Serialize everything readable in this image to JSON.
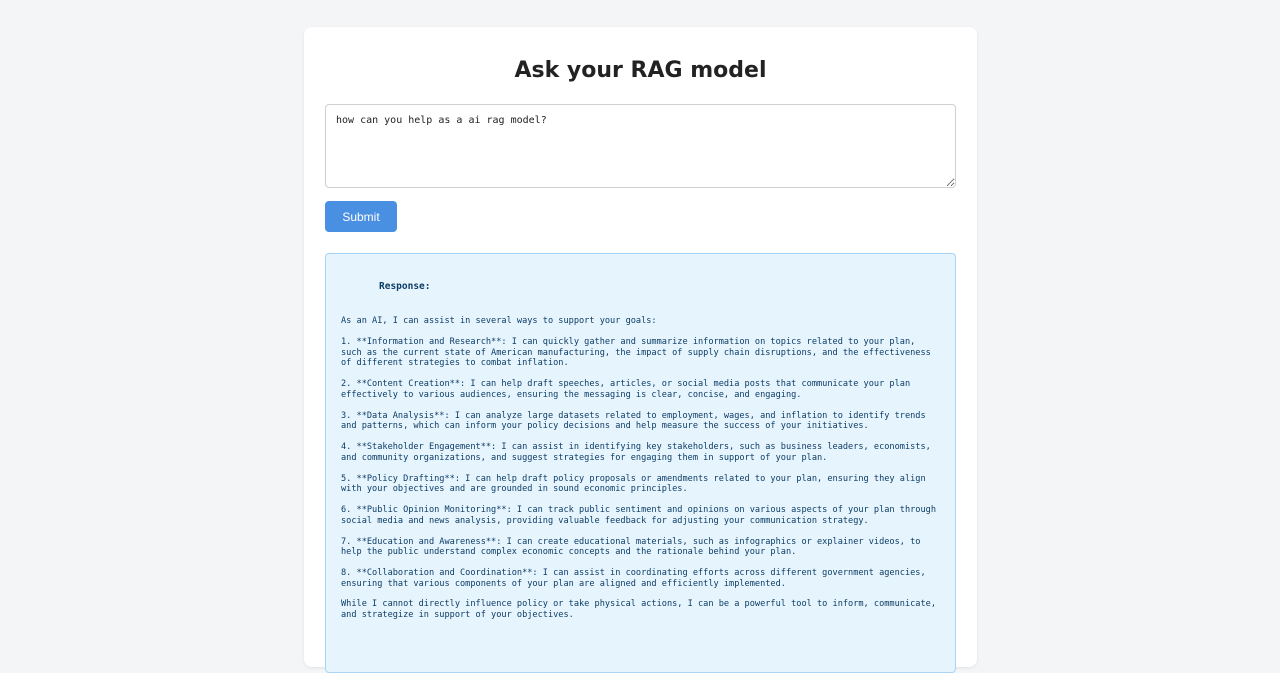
{
  "page": {
    "title": "Ask your RAG model"
  },
  "form": {
    "query_value": "how can you help as a ai rag model?",
    "submit_label": "Submit"
  },
  "response": {
    "label": "Response:",
    "intro": "As an AI, I can assist in several ways to support your goals:",
    "items": [
      "1. **Information and Research**: I can quickly gather and summarize information on topics related to your plan, such as the current state of American manufacturing, the impact of supply chain disruptions, and the effectiveness of different strategies to combat inflation.",
      "2. **Content Creation**: I can help draft speeches, articles, or social media posts that communicate your plan effectively to various audiences, ensuring the messaging is clear, concise, and engaging.",
      "3. **Data Analysis**: I can analyze large datasets related to employment, wages, and inflation to identify trends and patterns, which can inform your policy decisions and help measure the success of your initiatives.",
      "4. **Stakeholder Engagement**: I can assist in identifying key stakeholders, such as business leaders, economists, and community organizations, and suggest strategies for engaging them in support of your plan.",
      "5. **Policy Drafting**: I can help draft policy proposals or amendments related to your plan, ensuring they align with your objectives and are grounded in sound economic principles.",
      "6. **Public Opinion Monitoring**: I can track public sentiment and opinions on various aspects of your plan through social media and news analysis, providing valuable feedback for adjusting your communication strategy.",
      "7. **Education and Awareness**: I can create educational materials, such as infographics or explainer videos, to help the public understand complex economic concepts and the rationale behind your plan.",
      "8. **Collaboration and Coordination**: I can assist in coordinating efforts across different government agencies, ensuring that various components of your plan are aligned and efficiently implemented."
    ],
    "outro": "While I cannot directly influence policy or take physical actions, I can be a powerful tool to inform, communicate, and strategize in support of your objectives."
  },
  "colors": {
    "background": "#f4f5f7",
    "card": "#ffffff",
    "accent": "#4a90e2",
    "response_bg": "#e6f4fd",
    "response_border": "#a9d4f5",
    "response_text": "#0d3d66"
  }
}
